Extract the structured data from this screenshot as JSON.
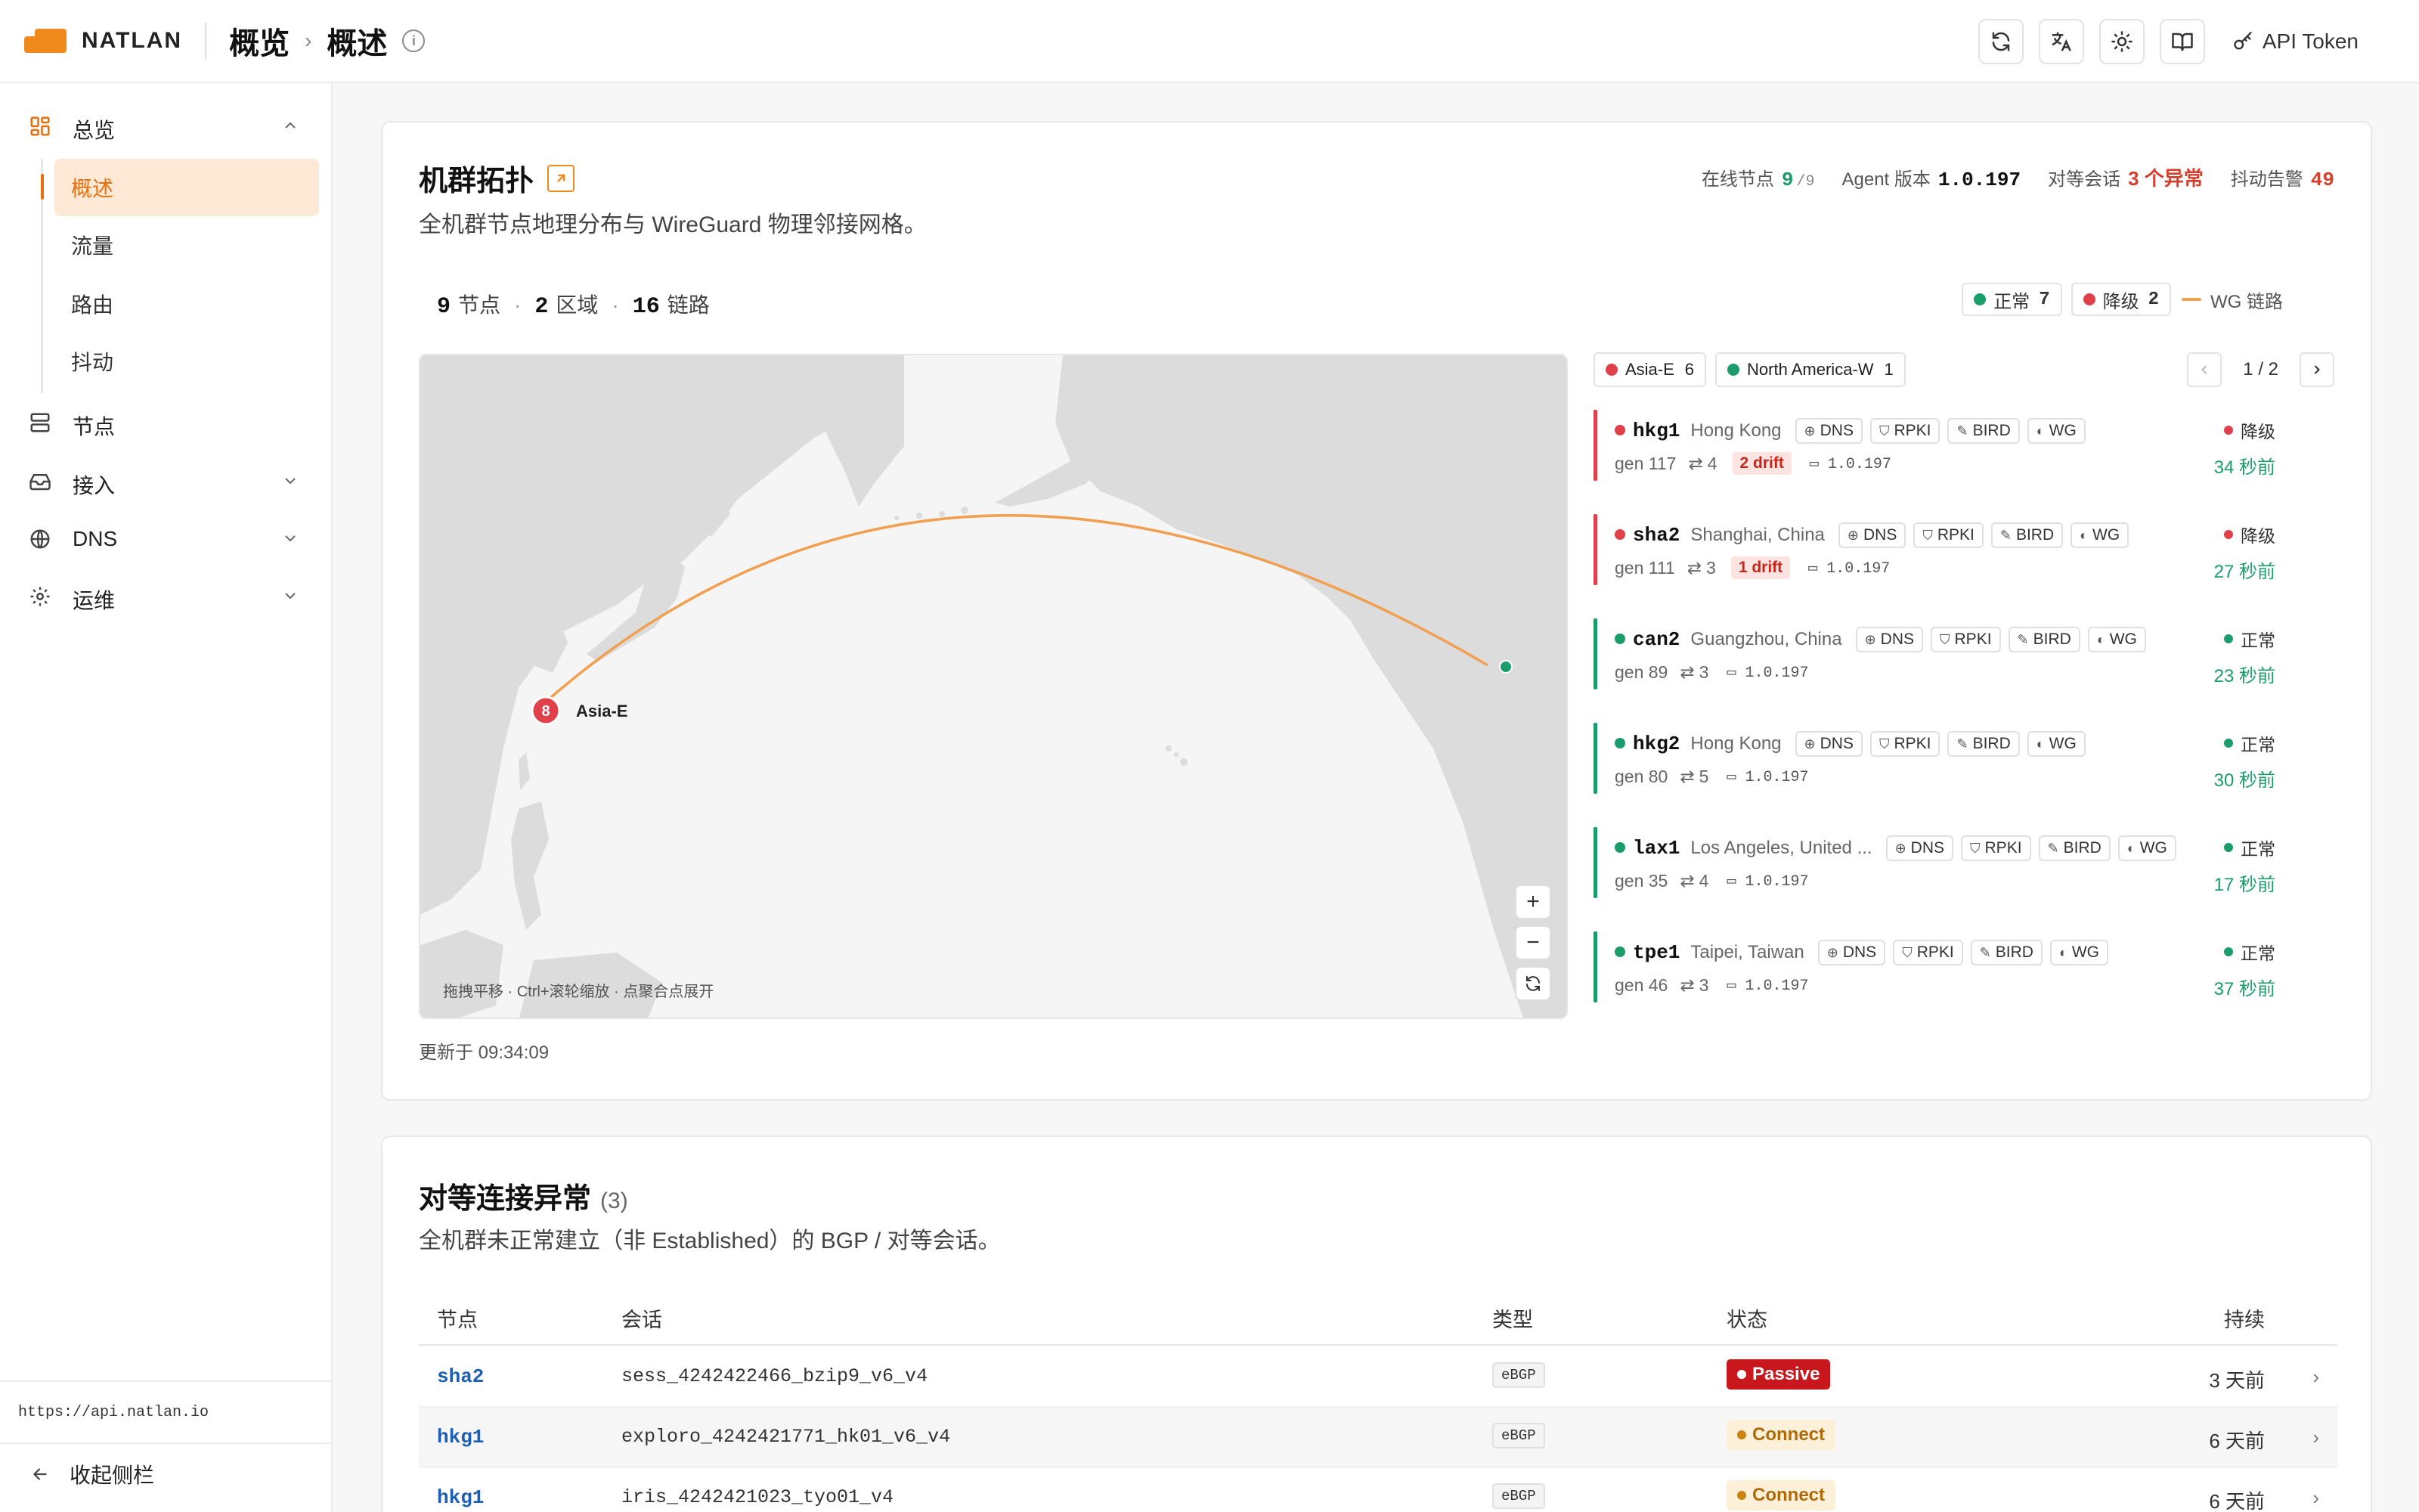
{
  "brand": {
    "name": "NATLAN",
    "color": "#f08a1c"
  },
  "breadcrumb": {
    "root": "概览",
    "current": "概述"
  },
  "topbar": {
    "api_token_label": "API Token"
  },
  "sidebar": {
    "overview_group": "总览",
    "overview_items": [
      "概述",
      "流量",
      "路由",
      "抖动"
    ],
    "active_item": "概述",
    "nodes": "节点",
    "access": "接入",
    "dns": "DNS",
    "ops": "运维",
    "api_url": "https://api.natlan.io",
    "collapse_label": "收起侧栏"
  },
  "topology": {
    "title": "机群拓扑",
    "subtitle": "全机群节点地理分布与 WireGuard 物理邻接网格。",
    "stats": {
      "online_label": "在线节点",
      "online_value": "9",
      "online_total": "/9",
      "agent_label": "Agent 版本",
      "agent_value": "1.0.197",
      "peer_label": "对等会话",
      "peer_value": "3 个异常",
      "flap_label": "抖动告警",
      "flap_value": "49"
    },
    "summary": {
      "nodes_count": "9",
      "nodes_label": "节点",
      "regions_count": "2",
      "regions_label": "区域",
      "links_count": "16",
      "links_label": "链路"
    },
    "legend": {
      "ok_label": "正常",
      "ok_count": "7",
      "degraded_label": "降级",
      "degraded_count": "2",
      "wg_label": "WG 链路"
    },
    "map": {
      "cluster_count": "8",
      "cluster_label": "Asia-E",
      "hint": "拖拽平移 · Ctrl+滚轮缩放 · 点聚合点展开",
      "zoom_in": "+",
      "zoom_out": "−"
    },
    "updated": "更新于 09:34:09",
    "region_tabs": [
      {
        "name": "Asia-E",
        "count": "6",
        "color": "#e0404a"
      },
      {
        "name": "North America-W",
        "count": "1",
        "color": "#1a9c6b"
      }
    ],
    "pager": "1 / 2",
    "tag_labels": {
      "dns": "DNS",
      "rpki": "RPKI",
      "bird": "BIRD",
      "wg": "WG"
    },
    "nodes": [
      {
        "name": "hkg1",
        "location": "Hong Kong",
        "gen": "gen 117",
        "peers": "4",
        "drift": "2 drift",
        "version": "1.0.197",
        "status": "降级",
        "ago": "34 秒前",
        "color": "#e0404a"
      },
      {
        "name": "sha2",
        "location": "Shanghai, China",
        "gen": "gen 111",
        "peers": "3",
        "drift": "1 drift",
        "version": "1.0.197",
        "status": "降级",
        "ago": "27 秒前",
        "color": "#e0404a"
      },
      {
        "name": "can2",
        "location": "Guangzhou, China",
        "gen": "gen 89",
        "peers": "3",
        "drift": "",
        "version": "1.0.197",
        "status": "正常",
        "ago": "23 秒前",
        "color": "#1a9c6b"
      },
      {
        "name": "hkg2",
        "location": "Hong Kong",
        "gen": "gen 80",
        "peers": "5",
        "drift": "",
        "version": "1.0.197",
        "status": "正常",
        "ago": "30 秒前",
        "color": "#1a9c6b"
      },
      {
        "name": "lax1",
        "location": "Los Angeles, United ...",
        "gen": "gen 35",
        "peers": "4",
        "drift": "",
        "version": "1.0.197",
        "status": "正常",
        "ago": "17 秒前",
        "color": "#1a9c6b"
      },
      {
        "name": "tpe1",
        "location": "Taipei, Taiwan",
        "gen": "gen 46",
        "peers": "3",
        "drift": "",
        "version": "1.0.197",
        "status": "正常",
        "ago": "37 秒前",
        "color": "#1a9c6b"
      }
    ]
  },
  "peers": {
    "title": "对等连接异常",
    "count": "(3)",
    "subtitle": "全机群未正常建立（非 Established）的 BGP / 对等会话。",
    "columns": {
      "node": "节点",
      "session": "会话",
      "type": "类型",
      "state": "状态",
      "duration": "持续"
    },
    "rows": [
      {
        "node": "sha2",
        "session": "sess_4242422466_bzip9_v6_v4",
        "type": "eBGP",
        "state": "Passive",
        "duration": "3 天前"
      },
      {
        "node": "hkg1",
        "session": "exploro_4242421771_hk01_v6_v4",
        "type": "eBGP",
        "state": "Connect",
        "duration": "6 天前"
      },
      {
        "node": "hkg1",
        "session": "iris_4242421023_tyo01_v4",
        "type": "eBGP",
        "state": "Connect",
        "duration": "6 天前"
      }
    ]
  },
  "colors": {
    "accent": "#e86f0c",
    "ok": "#1a9c6b",
    "bad": "#e0404a",
    "link": "#f0a050"
  }
}
